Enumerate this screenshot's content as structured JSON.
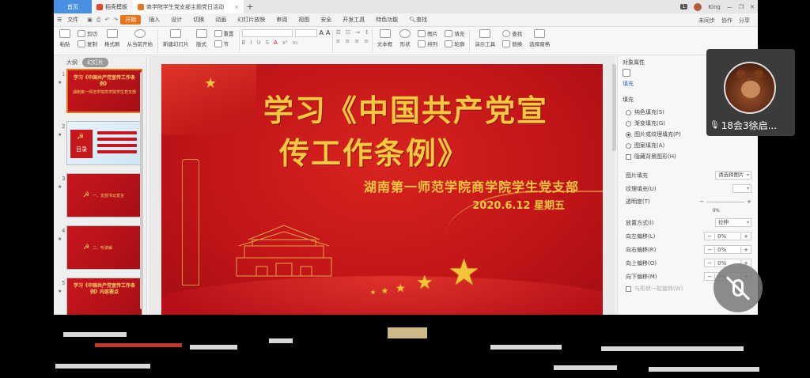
{
  "titlebar": {
    "home_tab": "首页",
    "doc_tab": "稻壳模板",
    "active_tab": "商学院学生党支部主题党日活动",
    "user": "King",
    "badge": "1"
  },
  "menubar": {
    "file": "文件",
    "items": [
      "开始",
      "插入",
      "设计",
      "切换",
      "动画",
      "幻灯片放映",
      "审阅",
      "视图",
      "安全",
      "开发工具",
      "特色功能"
    ],
    "active_index": 0,
    "search": "查找",
    "right": [
      "未同步",
      "协作",
      "分享"
    ]
  },
  "ribbon": {
    "paste": "粘贴",
    "cut": "剪切",
    "copy": "复制",
    "format_painter": "格式刷",
    "from_current": "从当前开始",
    "new_slide": "新建幻灯片",
    "layout": "版式",
    "section": "节",
    "reset": "重置",
    "textbox": "文本框",
    "shape": "形状",
    "arrange": "排列",
    "outline": "轮廓",
    "picture": "图片",
    "fill": "填充",
    "presenter": "演示工具",
    "find": "查找",
    "replace": "替换",
    "select_pane": "选择窗格"
  },
  "leftpane": {
    "tabs": [
      "大纲",
      "幻灯片"
    ],
    "active_tab": 1,
    "slides": [
      {
        "num": "1",
        "title": "学习《中国共产党宣传工作条例》",
        "sub": "湖南第一师范学院商学院学生党支部"
      },
      {
        "num": "2",
        "title": "目录"
      },
      {
        "num": "3",
        "title": "一、支部书记发言"
      },
      {
        "num": "4",
        "title": "二、听讲解"
      },
      {
        "num": "5",
        "title": "学习《中国共产党宣传工作条例》内容要点"
      }
    ]
  },
  "slide": {
    "title_line1": "学习《中国共产党宣",
    "title_line2": "传工作条例》",
    "subtitle": "湖南第一师范学院商学院学生党支部",
    "date": "2020.6.12  星期五"
  },
  "rightpane": {
    "header": "对象属性",
    "tab": "填充",
    "section": "填充",
    "options": [
      "纯色填充(S)",
      "渐变填充(G)",
      "图片或纹理填充(P)",
      "图案填充(A)"
    ],
    "selected_option": 2,
    "hide_bg": "隐藏背景图形(H)",
    "picture_fill_label": "图片填充",
    "picture_fill_value": "请选择图片",
    "texture_label": "纹理填充(U)",
    "transparency_label": "透明度(T)",
    "transparency_value": "0%",
    "placement_label": "放置方式(I)",
    "placement_value": "拉伸",
    "offsets": [
      {
        "label": "向左偏移(L)",
        "value": "0%"
      },
      {
        "label": "向右偏移(R)",
        "value": "0%"
      },
      {
        "label": "向上偏移(O)",
        "value": "0%"
      },
      {
        "label": "向下偏移(M)",
        "value": "0%"
      }
    ],
    "rotate_with_shape": "与形状一起旋转(W)"
  },
  "video": {
    "name": "18会3徐启..."
  },
  "colors": {
    "accent": "#e8741c",
    "slide_red": "#c8161d",
    "gold": "#f3c93f"
  }
}
